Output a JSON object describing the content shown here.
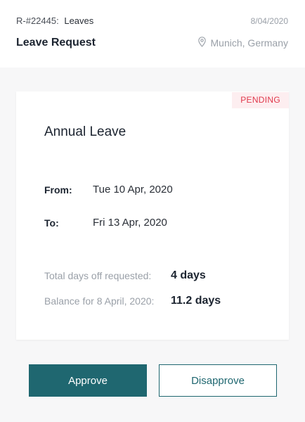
{
  "header": {
    "request_id": "R-#22445:",
    "request_type": "Leaves",
    "date": "8/04/2020",
    "title": "Leave Request",
    "location": "Munich, Germany"
  },
  "card": {
    "status": "PENDING",
    "leave_type": "Annual Leave",
    "from_label": "From:",
    "from_value": "Tue 10 Apr, 2020",
    "to_label": "To:",
    "to_value": "Fri 13 Apr, 2020",
    "total_label": "Total days off requested:",
    "total_value": "4 days",
    "balance_label": "Balance for 8 April, 2020:",
    "balance_value": "11.2 days"
  },
  "actions": {
    "approve_label": "Approve",
    "disapprove_label": "Disapprove"
  },
  "colors": {
    "accent": "#1f6770",
    "pending": "#e0384b"
  },
  "icons": {
    "location": "location-pin-icon"
  }
}
